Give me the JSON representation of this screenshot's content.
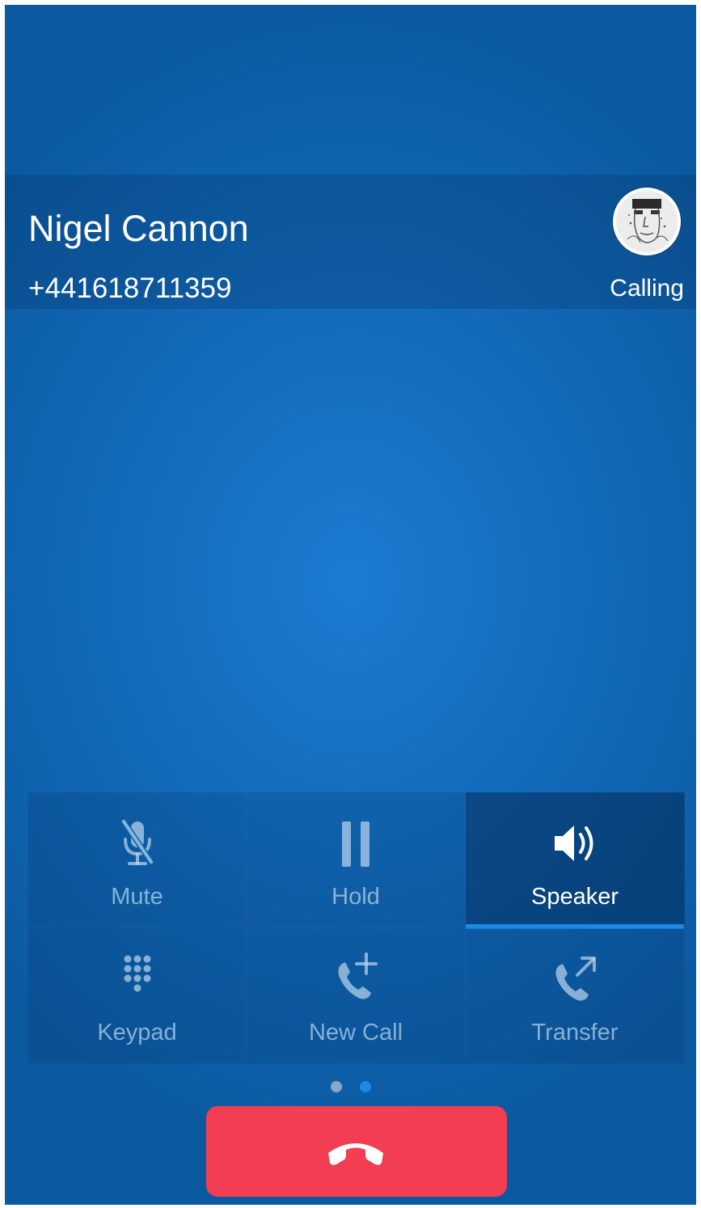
{
  "contact": {
    "name": "Nigel Cannon",
    "number": "+441618711359",
    "status": "Calling"
  },
  "controls": [
    {
      "label": "Mute",
      "icon": "microphone-muted-icon",
      "active": false
    },
    {
      "label": "Hold",
      "icon": "pause-icon",
      "active": false
    },
    {
      "label": "Speaker",
      "icon": "speaker-icon",
      "active": true
    },
    {
      "label": "Keypad",
      "icon": "keypad-icon",
      "active": false
    },
    {
      "label": "New Call",
      "icon": "phone-add-icon",
      "active": false
    },
    {
      "label": "Transfer",
      "icon": "phone-transfer-icon",
      "active": false
    }
  ],
  "pager": {
    "pages": 2,
    "current": 2
  },
  "hangup": {
    "icon": "phone-hangup-icon",
    "color": "#f23d52"
  },
  "colors": {
    "background": "#136cbd",
    "accent": "#1e88e5",
    "hangup": "#f23d52"
  }
}
